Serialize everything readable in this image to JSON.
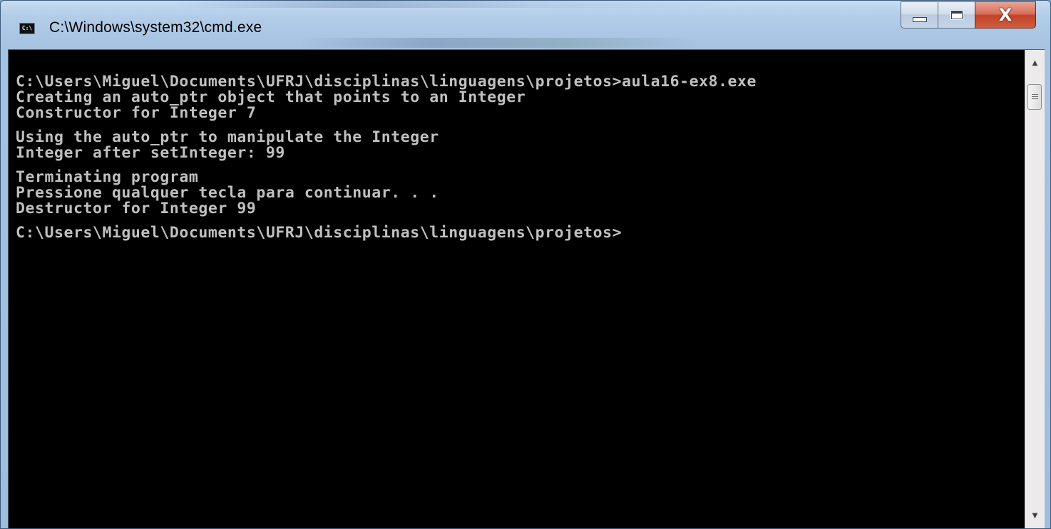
{
  "window": {
    "title": "C:\\Windows\\system32\\cmd.exe",
    "icon_label": "C:\\",
    "icon": "cmd-icon",
    "buttons": {
      "minimize_icon": "minimize-icon",
      "maximize_icon": "maximize-icon",
      "close_icon": "close-icon",
      "close_glyph": "X"
    },
    "accent_close": "#c2432a"
  },
  "console": {
    "text_color": "#c0c0c0",
    "background": "#000000",
    "lines": [
      "C:\\Users\\Miguel\\Documents\\UFRJ\\disciplinas\\linguagens\\projetos>aula16-ex8.exe",
      "Creating an auto_ptr object that points to an Integer",
      "Constructor for Integer 7",
      "",
      "Using the auto_ptr to manipulate the Integer",
      "Integer after setInteger: 99",
      "",
      "Terminating program",
      "Pressione qualquer tecla para continuar. . .",
      "Destructor for Integer 99",
      "",
      "C:\\Users\\Miguel\\Documents\\UFRJ\\disciplinas\\linguagens\\projetos>"
    ]
  },
  "scrollbar": {
    "up_glyph": "▲",
    "down_glyph": "▼"
  }
}
